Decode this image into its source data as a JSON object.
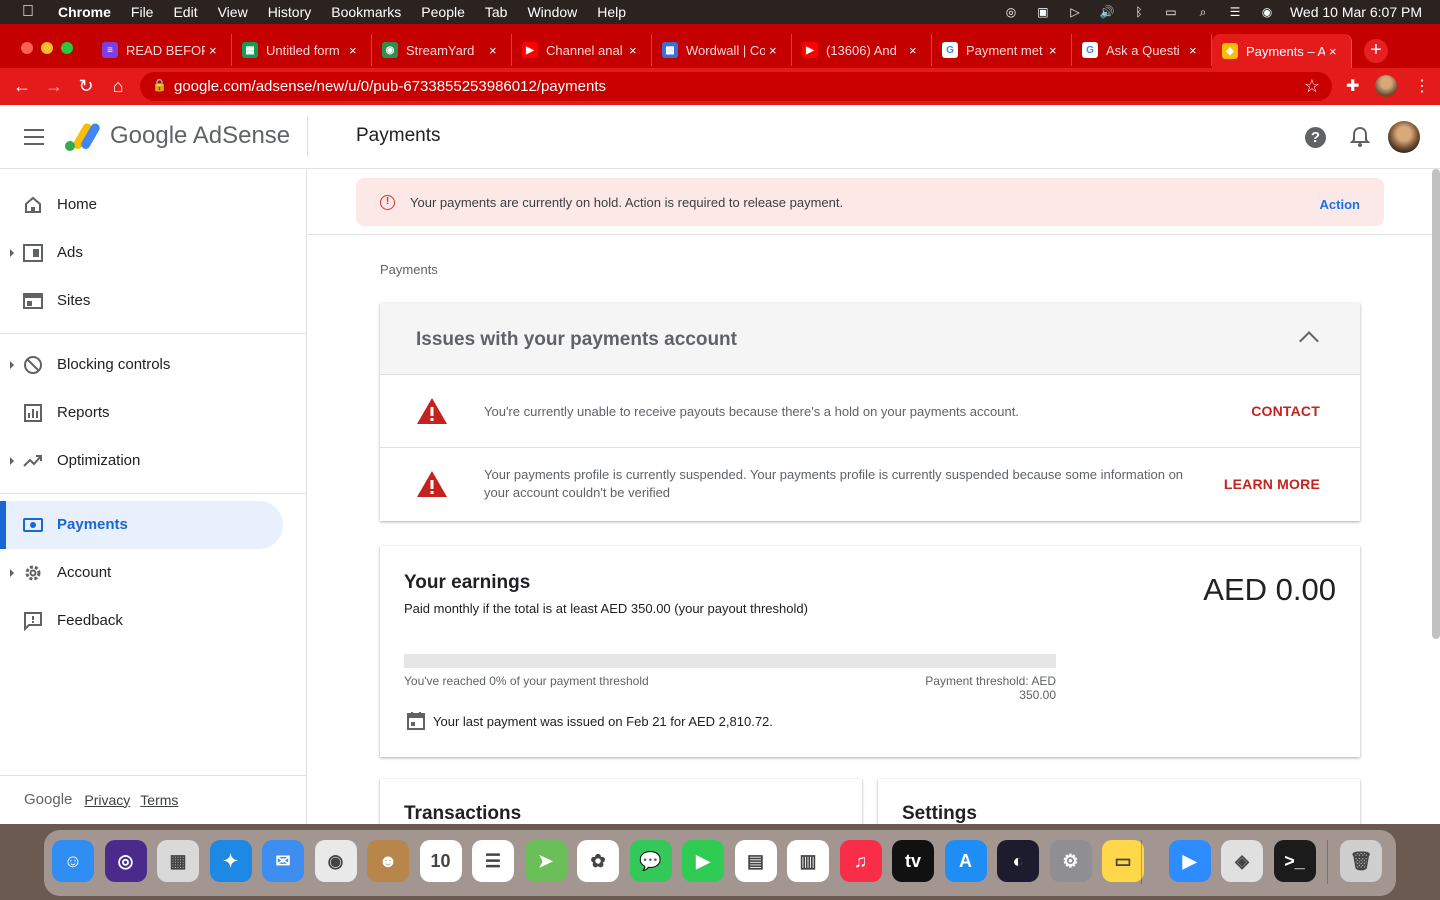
{
  "menubar": {
    "app": "Chrome",
    "items": [
      "File",
      "Edit",
      "View",
      "History",
      "Bookmarks",
      "People",
      "Tab",
      "Window",
      "Help"
    ],
    "datetime": "Wed 10 Mar  6:07 PM"
  },
  "browser": {
    "tabs": [
      {
        "label": "READ BEFOR",
        "color": "#7b3fe4",
        "glyph": "≡"
      },
      {
        "label": "Untitled form",
        "color": "#0f9d58",
        "glyph": "▦"
      },
      {
        "label": "StreamYard",
        "color": "#2f8f4e",
        "glyph": "◉"
      },
      {
        "label": "Channel anal",
        "color": "#ff0000",
        "glyph": "▶"
      },
      {
        "label": "Wordwall | Co",
        "color": "#3b6fd8",
        "glyph": "▩"
      },
      {
        "label": "(13606) And",
        "color": "#ff0000",
        "glyph": "▶"
      },
      {
        "label": "Payment met",
        "color": "#ffffff",
        "glyph": "G"
      },
      {
        "label": "Ask a Questi",
        "color": "#ffffff",
        "glyph": "G"
      },
      {
        "label": "Payments – A",
        "color": "#fbbc04",
        "glyph": "◆",
        "active": true
      }
    ],
    "url": "google.com/adsense/new/u/0/pub-6733855253986012/payments"
  },
  "app": {
    "brand": "Google AdSense",
    "page_title": "Payments"
  },
  "sidebar": {
    "items": [
      {
        "label": "Home",
        "icon": "home-icon",
        "caret": false
      },
      {
        "label": "Ads",
        "icon": "ads-icon",
        "caret": true
      },
      {
        "label": "Sites",
        "icon": "sites-icon",
        "caret": false
      },
      {
        "label": "Blocking controls",
        "icon": "block-icon",
        "caret": true
      },
      {
        "label": "Reports",
        "icon": "reports-icon",
        "caret": false
      },
      {
        "label": "Optimization",
        "icon": "trending-icon",
        "caret": true
      },
      {
        "label": "Payments",
        "icon": "payments-icon",
        "caret": false,
        "active": true
      },
      {
        "label": "Account",
        "icon": "gear-icon",
        "caret": true
      },
      {
        "label": "Feedback",
        "icon": "feedback-icon",
        "caret": false
      }
    ],
    "footer": {
      "google": "Google",
      "privacy": "Privacy",
      "terms": "Terms"
    }
  },
  "alert": {
    "text": "Your payments are currently on hold. Action is required to release payment.",
    "action": "Action"
  },
  "breadcrumb": "Payments",
  "issues": {
    "title": "Issues with your payments account",
    "rows": [
      {
        "text": "You're currently unable to receive payouts because there's a hold on your payments account.",
        "link": "CONTACT"
      },
      {
        "text": "Your payments profile is currently suspended. Your payments profile is currently suspended because some information on your account couldn't be verified",
        "link": "LEARN MORE"
      }
    ]
  },
  "earnings": {
    "title": "Your earnings",
    "subtitle": "Paid monthly if the total is at least AED 350.00 (your payout threshold)",
    "amount": "AED 0.00",
    "progress_percent": 0,
    "progress_label": "You've reached 0% of your payment threshold",
    "threshold_label": "Payment threshold: AED 350.00",
    "last_payment": "Your last payment was issued on Feb 21 for AED 2,810.72."
  },
  "cards": {
    "transactions": "Transactions",
    "settings": "Settings"
  },
  "dock": {
    "apps": [
      {
        "name": "finder-icon",
        "color": "#2f8ef3",
        "glyph": "☺"
      },
      {
        "name": "siri-icon",
        "color": "#4a2b8c",
        "glyph": "◎"
      },
      {
        "name": "launchpad-icon",
        "color": "#d9d9d9",
        "glyph": "▦"
      },
      {
        "name": "safari-icon",
        "color": "#1e88e5",
        "glyph": "✦"
      },
      {
        "name": "mail-icon",
        "color": "#3d8ef0",
        "glyph": "✉"
      },
      {
        "name": "chrome-icon",
        "color": "#e9e9e9",
        "glyph": "◉"
      },
      {
        "name": "contacts-icon",
        "color": "#b8864b",
        "glyph": "☻"
      },
      {
        "name": "calendar-icon",
        "color": "#ffffff",
        "glyph": "10"
      },
      {
        "name": "reminders-icon",
        "color": "#ffffff",
        "glyph": "☰"
      },
      {
        "name": "maps-icon",
        "color": "#6bbf59",
        "glyph": "➤"
      },
      {
        "name": "photos-icon",
        "color": "#ffffff",
        "glyph": "✿"
      },
      {
        "name": "messages-icon",
        "color": "#34c759",
        "glyph": "💬"
      },
      {
        "name": "facetime-icon",
        "color": "#2ecc52",
        "glyph": "▶"
      },
      {
        "name": "keynote-icon",
        "color": "#ffffff",
        "glyph": "▤"
      },
      {
        "name": "numbers-icon",
        "color": "#ffffff",
        "glyph": "▥"
      },
      {
        "name": "music-icon",
        "color": "#fa2d48",
        "glyph": "♫"
      },
      {
        "name": "tv-icon",
        "color": "#111111",
        "glyph": "tv"
      },
      {
        "name": "appstore-icon",
        "color": "#1e8ef5",
        "glyph": "A"
      },
      {
        "name": "obs-icon",
        "color": "#1c1c2e",
        "glyph": "◐"
      },
      {
        "name": "system-preferences-icon",
        "color": "#8e8e93",
        "glyph": "⚙"
      },
      {
        "name": "notes-icon",
        "color": "#ffd84a",
        "glyph": "▭"
      },
      {
        "name": "zoom-icon",
        "color": "#2d8cff",
        "glyph": "▶"
      },
      {
        "name": "preview-icon",
        "color": "#e0e0e0",
        "glyph": "◈"
      },
      {
        "name": "terminal-icon",
        "color": "#1b1b1b",
        "glyph": ">_"
      },
      {
        "name": "trash-icon",
        "color": "#cfcfcf",
        "glyph": "🗑"
      }
    ]
  }
}
